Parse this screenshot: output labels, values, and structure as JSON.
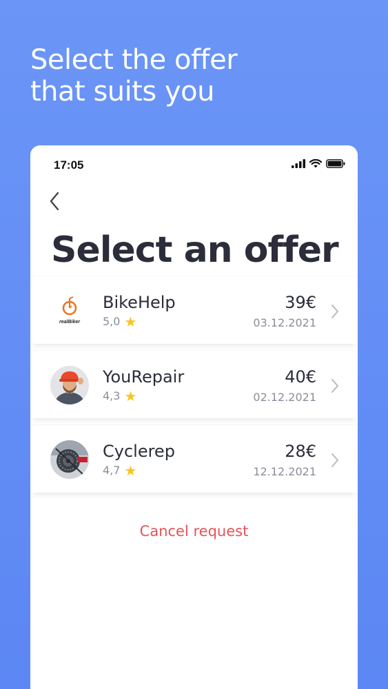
{
  "headline": {
    "line1": "Select the offer",
    "line2": "that suits you"
  },
  "status_bar": {
    "time": "17:05"
  },
  "page_title": "Select an offer",
  "offers": [
    {
      "name": "BikeHelp",
      "rating": "5,0",
      "price": "39€",
      "date": "03.12.2021",
      "avatar": "realbiker-logo"
    },
    {
      "name": "YouRepair",
      "rating": "4,3",
      "price": "40€",
      "date": "02.12.2021",
      "avatar": "worker-photo"
    },
    {
      "name": "Cyclerep",
      "rating": "4,7",
      "price": "28€",
      "date": "12.12.2021",
      "avatar": "bike-gear-photo"
    }
  ],
  "logo_text": "realBiker",
  "cancel_label": "Cancel request",
  "colors": {
    "background": "#6b95f6",
    "star": "#f7c421",
    "cancel": "#e5535a",
    "text": "#2b2d3a",
    "muted": "#8a8d99"
  },
  "icons": {
    "back": "chevron-left-icon",
    "row": "chevron-right-icon",
    "star": "star-icon"
  }
}
